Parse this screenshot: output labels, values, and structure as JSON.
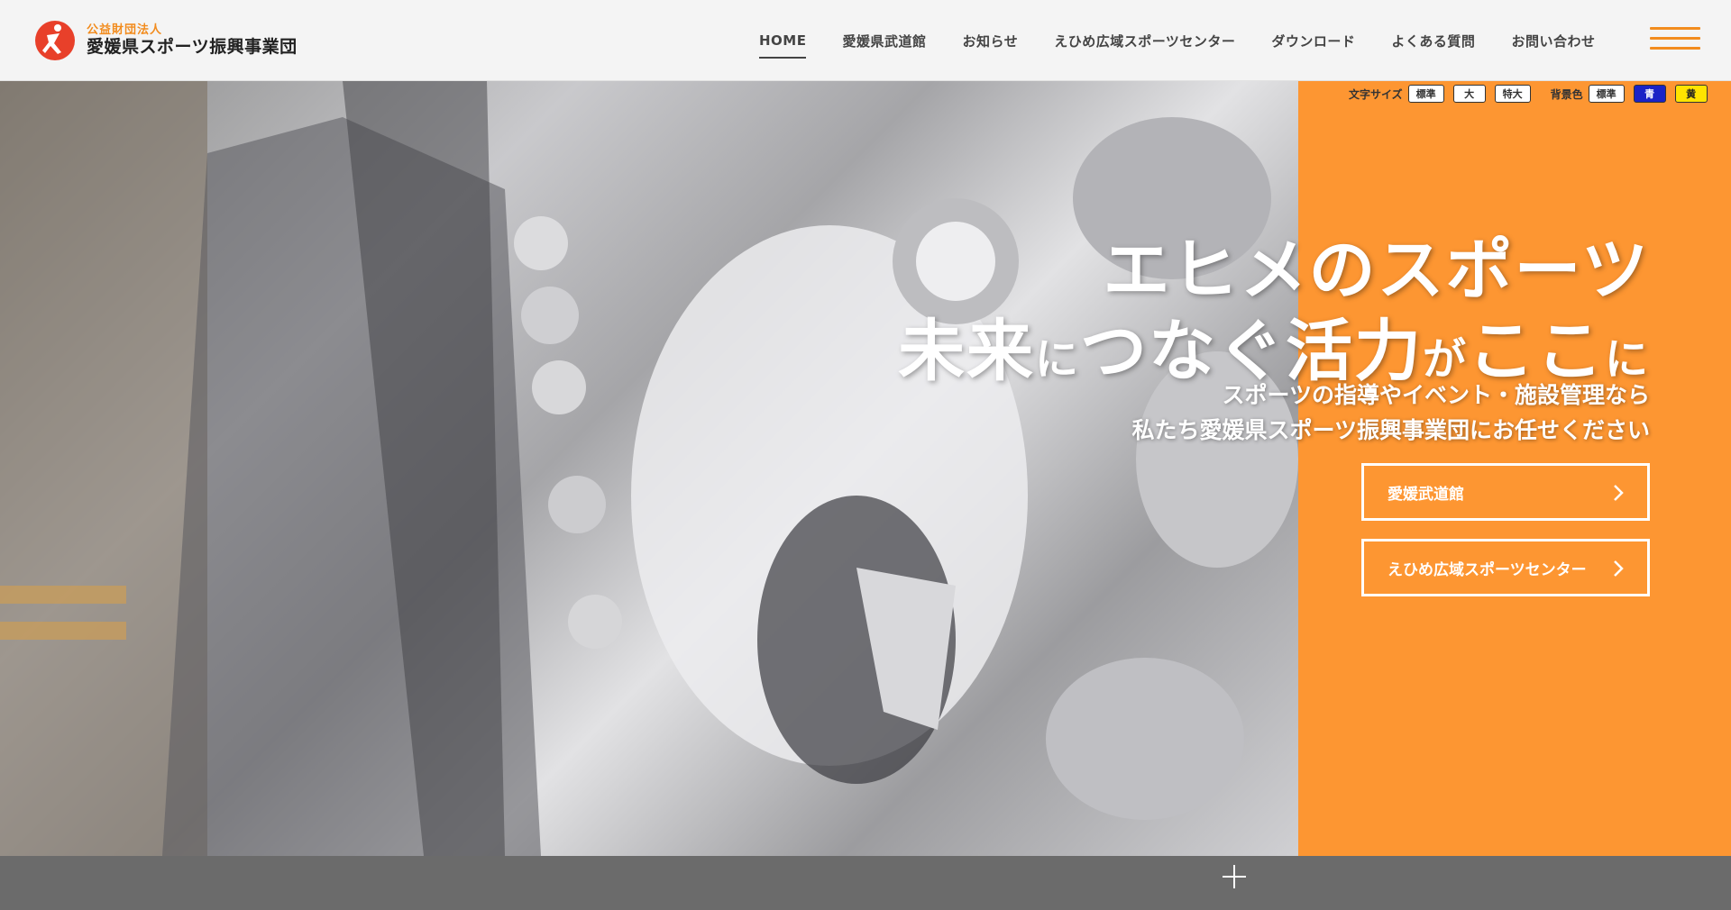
{
  "logo": {
    "sub": "公益財団法人",
    "main": "愛媛県スポーツ振興事業団",
    "mark_colors": {
      "circle": "#e8402a",
      "figure": "#ffffff"
    }
  },
  "nav": {
    "items": [
      {
        "label": "HOME",
        "active": true
      },
      {
        "label": "愛媛県武道館"
      },
      {
        "label": "お知らせ"
      },
      {
        "label": "えひめ広域スポーツセンター"
      },
      {
        "label": "ダウンロード"
      },
      {
        "label": "よくある質問"
      },
      {
        "label": "お問い合わせ"
      }
    ],
    "menu_icon": "hamburger-icon"
  },
  "a11y": {
    "font_size_label": "文字サイズ",
    "font_size_options": [
      "標準",
      "大",
      "特大"
    ],
    "bg_color_label": "背景色",
    "bg_color_options": [
      "標準",
      "青",
      "黄"
    ]
  },
  "hero": {
    "catch_line1": "エヒメのスポーツ",
    "catch_line2_parts": [
      "未来",
      "に",
      "つなぐ活力",
      "が",
      "ここ",
      "に"
    ],
    "sub_line1": "スポーツの指導やイベント・施設管理なら",
    "sub_line2": "私たち愛媛県スポーツ振興事業団にお任せください",
    "cta1": "愛媛武道館",
    "cta2": "えひめ広域スポーツセンター",
    "accent_color": "#fd9632"
  },
  "bottom": {
    "icon": "plus-icon"
  }
}
